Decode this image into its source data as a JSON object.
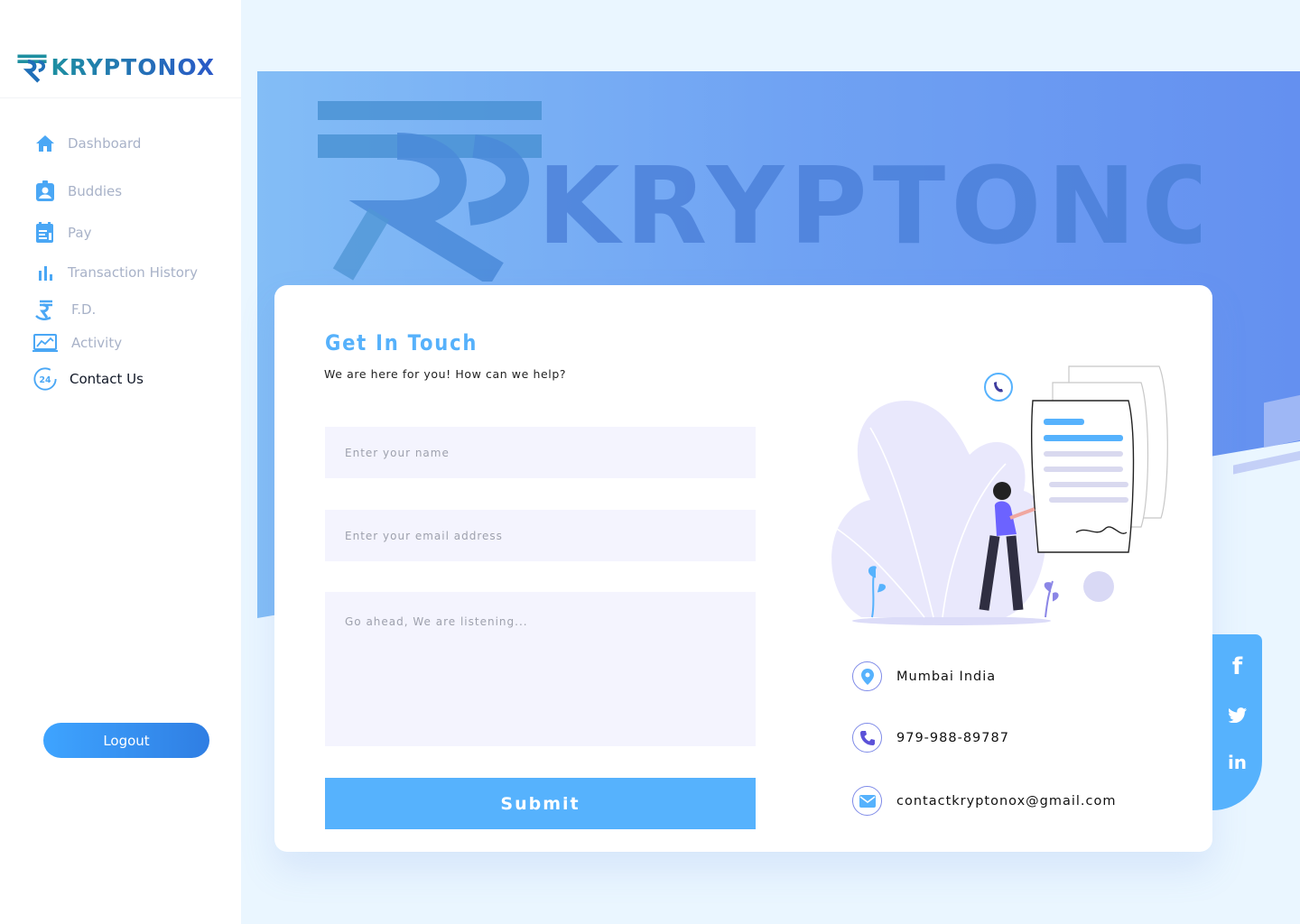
{
  "brand": {
    "name": "KRYPTONOX"
  },
  "sidebar": {
    "items": [
      {
        "label": "Dashboard",
        "icon": "home-icon"
      },
      {
        "label": "Buddies",
        "icon": "contact-badge-icon"
      },
      {
        "label": "Pay",
        "icon": "invoice-icon"
      },
      {
        "label": "Transaction History",
        "icon": "bar-chart-icon"
      },
      {
        "label": "F.D.",
        "icon": "rupee-hand-icon"
      },
      {
        "label": "Activity",
        "icon": "monitor-chart-icon"
      },
      {
        "label": "Contact Us",
        "icon": "support-24-icon",
        "active": true
      }
    ],
    "logout_label": "Logout"
  },
  "contact": {
    "title": "Get In Touch",
    "subtitle": "We are here for you! How can we help?",
    "name_placeholder": "Enter your name",
    "email_placeholder": "Enter your email address",
    "message_placeholder": "Go ahead, We are listening...",
    "submit_label": "Submit",
    "location": "Mumbai India",
    "phone": "979-988-89787",
    "email": "contactkryptonox@gmail.com"
  },
  "social": {
    "facebook": "f",
    "linkedin": "in"
  },
  "colors": {
    "accent": "#56b2fd",
    "hero_start": "#83bdf6",
    "hero_end": "#6490f0",
    "field_bg": "#f4f4fe"
  }
}
